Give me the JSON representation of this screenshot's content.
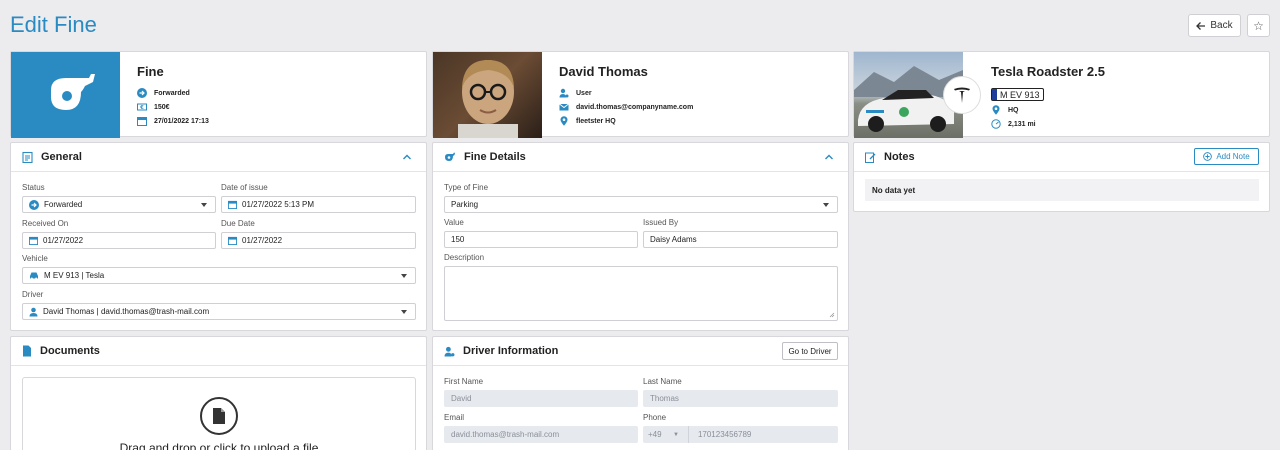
{
  "page": {
    "title": "Edit Fine"
  },
  "toolbar": {
    "back_label": "Back",
    "favorite_icon": "star-icon"
  },
  "fine_card": {
    "title": "Fine",
    "status": "Forwarded",
    "amount": "150€",
    "datetime": "27/01/2022 17:13",
    "accent": "#2a8bc2"
  },
  "driver_card": {
    "name": "David Thomas",
    "role": "User",
    "email": "david.thomas@companyname.com",
    "location": "fleetster HQ"
  },
  "vehicle_card": {
    "name": "Tesla Roadster 2.5",
    "plate": "M EV 913",
    "location": "HQ",
    "mileage": "2,131 mi"
  },
  "general": {
    "title": "General",
    "status_label": "Status",
    "status_value": "Forwarded",
    "date_issue_label": "Date of issue",
    "date_issue_value": "01/27/2022 5:13 PM",
    "received_label": "Received On",
    "received_value": "01/27/2022",
    "due_label": "Due Date",
    "due_value": "01/27/2022",
    "vehicle_label": "Vehicle",
    "vehicle_value": "M EV 913 | Tesla",
    "driver_label": "Driver",
    "driver_value": "David Thomas | david.thomas@trash-mail.com"
  },
  "fine_details": {
    "title": "Fine Details",
    "type_label": "Type of Fine",
    "type_value": "Parking",
    "value_label": "Value",
    "value_value": "150",
    "issued_label": "Issued By",
    "issued_value": "Daisy Adams",
    "description_label": "Description"
  },
  "notes": {
    "title": "Notes",
    "add_label": "Add Note",
    "empty_text": "No data yet"
  },
  "documents": {
    "title": "Documents",
    "drop_text": "Drag and drop or click to upload a file"
  },
  "driver_info": {
    "title": "Driver Information",
    "goto_label": "Go to Driver",
    "first_label": "First Name",
    "first_value": "David",
    "last_label": "Last Name",
    "last_value": "Thomas",
    "email_label": "Email",
    "email_value": "david.thomas@trash-mail.com",
    "phone_label": "Phone",
    "phone_code": "+49",
    "phone_value": "170123456789"
  }
}
